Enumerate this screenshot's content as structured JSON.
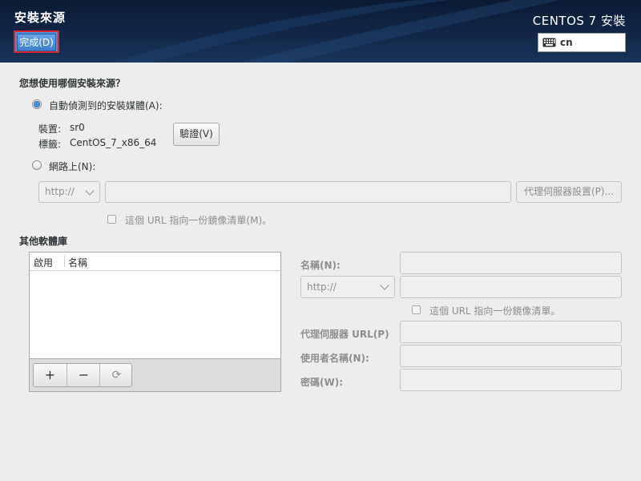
{
  "header": {
    "title": "安裝來源",
    "done_label": "完成(D)",
    "product": "CENTOS 7 安裝",
    "keyboard_layout": "cn"
  },
  "source": {
    "question": "您想使用哪個安裝來源？",
    "auto_label": "自動偵測到的安裝媒體(A):",
    "device_label": "裝置:",
    "device_value": "sr0",
    "tag_label": "標籤:",
    "tag_value": "CentOS_7_x86_64",
    "verify_label": "驗證(V)",
    "network_label": "網路上(N):",
    "protocol": "http://",
    "url_value": "",
    "proxy_button": "代理伺服器設置(P)...",
    "mirror_label": "這個 URL 指向一份鏡像清單(M)。"
  },
  "repos": {
    "section_title": "其他軟體庫",
    "col_enable": "啟用",
    "col_name": "名稱",
    "add": "+",
    "remove": "−",
    "refresh": "⟳"
  },
  "repo_detail": {
    "name_label": "名稱(N):",
    "protocol": "http://",
    "mirror_label": "這個 URL 指向一份鏡像清單。",
    "proxy_url_label": "代理伺服器 URL(P)",
    "user_label": "使用者名稱(N):",
    "password_label": "密碼(W):"
  },
  "colors": {
    "accent": "#4a90d9",
    "header_bg": "#12284a",
    "focus_ring": "#d8262f"
  }
}
